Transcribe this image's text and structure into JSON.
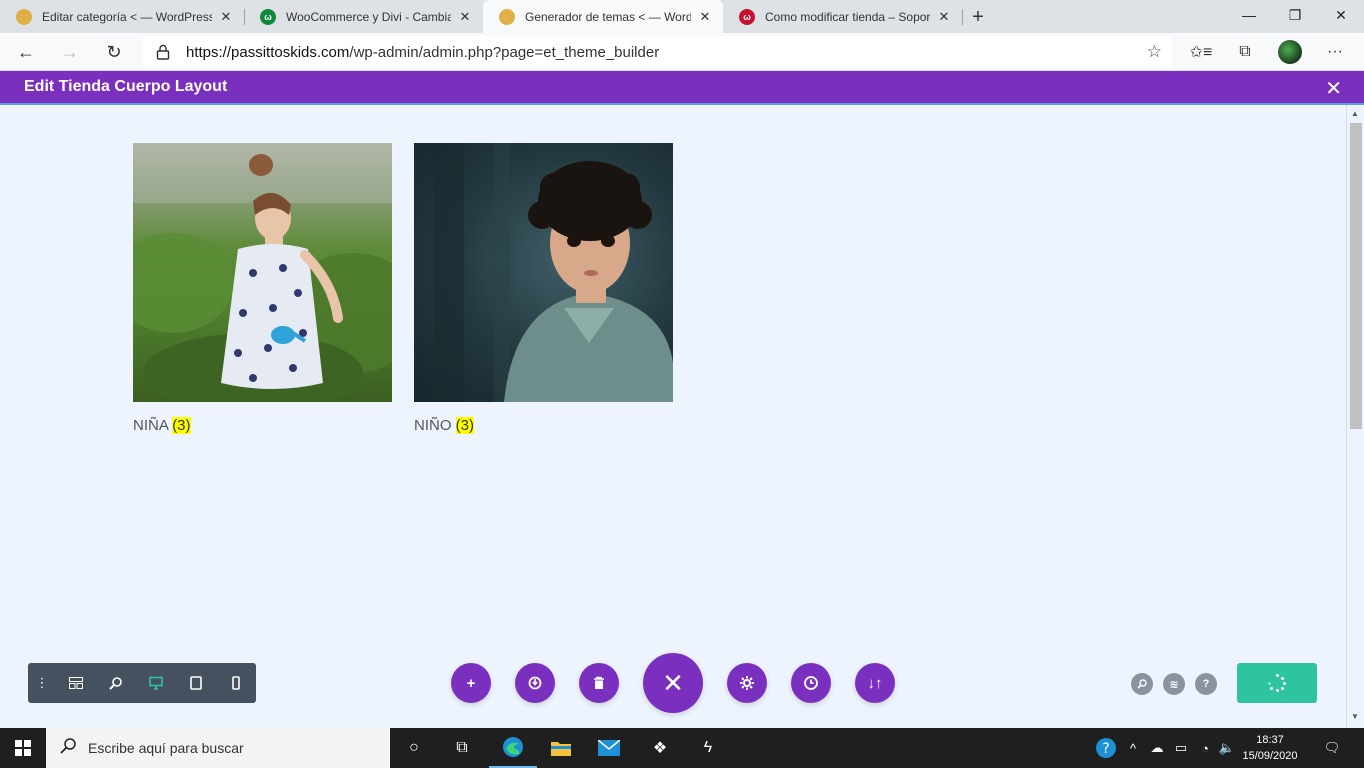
{
  "browser": {
    "tabs": [
      {
        "title": "Editar categoría < — WordPress",
        "favicon": "chrome-icon",
        "favicon_color": "#e0b046"
      },
      {
        "title": "WooCommerce y Divi - Cambiar",
        "favicon": "woo-icon",
        "favicon_color": "#0f8a3c"
      },
      {
        "title": "Generador de temas < — WordP",
        "favicon": "chrome-icon",
        "favicon_color": "#e0b046"
      },
      {
        "title": "Como modificar tienda – Soporte",
        "favicon": "woo-icon",
        "favicon_color": "#c8102e"
      }
    ],
    "active_tab": 2,
    "url_host": "https://passittoskids.com",
    "url_path": "/wp-admin/admin.php?page=et_theme_builder"
  },
  "divi": {
    "header_title": "Edit Tienda Cuerpo Layout",
    "accent_color": "#7b2fbe",
    "save_color": "#2ec4a0"
  },
  "categories": [
    {
      "name": "NIÑA",
      "count": "(3)",
      "image": "girl-watering-plants"
    },
    {
      "name": "NIÑO",
      "count": "(3)",
      "image": "curly-haired-boy"
    }
  ],
  "builder_toolbar": {
    "left": [
      "menu-dots-icon",
      "wireframe-icon",
      "zoom-icon",
      "desktop-icon",
      "tablet-icon",
      "phone-icon"
    ],
    "center": [
      "add-icon",
      "portability-icon",
      "trash-icon",
      "close-icon",
      "settings-icon",
      "history-icon",
      "sort-icon"
    ],
    "right": [
      "search-icon",
      "layers-icon",
      "help-icon"
    ]
  },
  "taskbar": {
    "search_placeholder": "Escribe aquí para buscar",
    "time": "18:37",
    "date": "15/09/2020"
  }
}
